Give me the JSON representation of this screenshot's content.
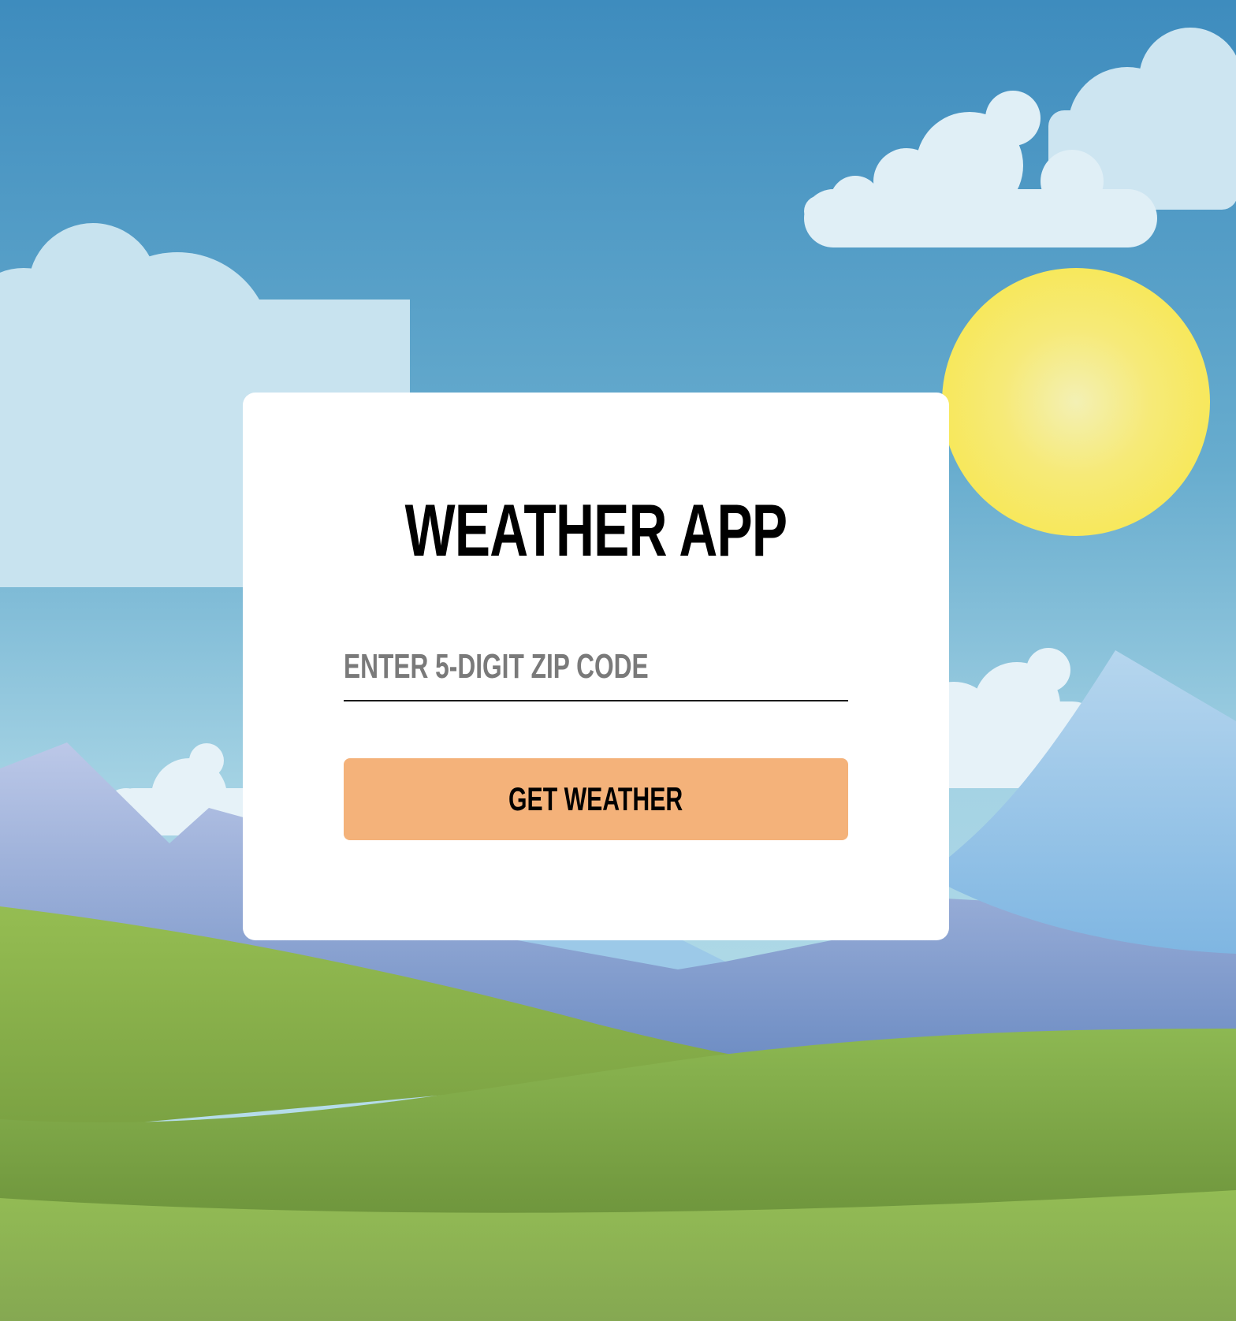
{
  "app": {
    "title": "WEATHER APP"
  },
  "zip": {
    "placeholder": "ENTER 5-DIGIT ZIP CODE",
    "value": ""
  },
  "actions": {
    "get_weather_label": "GET WEATHER"
  },
  "colors": {
    "button": "#f4b27a",
    "card": "#ffffff",
    "sky_top": "#3f8fbf",
    "sky_bottom": "#a9d6e6",
    "sun": "#f8ec62",
    "grass": "#8bb54f"
  }
}
